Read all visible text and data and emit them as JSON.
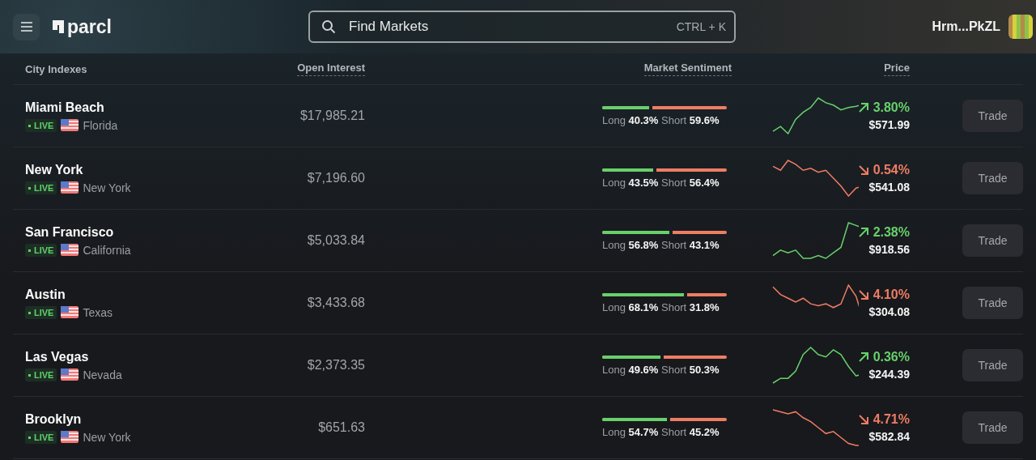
{
  "header": {
    "logo": "parcl",
    "search": {
      "placeholder": "Find Markets",
      "shortcut": "CTRL + K"
    },
    "account": "Hrm...PkZL"
  },
  "table": {
    "columns": [
      "City Indexes",
      "Open Interest",
      "Market Sentiment",
      "Price"
    ],
    "rows": [
      {
        "city": "Miami Beach",
        "status": "LIVE",
        "region": "Florida",
        "open_interest": "$17,985.21",
        "long_label": "Long",
        "long": "40.3%",
        "short_label": "Short",
        "short": "59.6%",
        "level": 0.403,
        "kind": "up",
        "change": "3.80%",
        "price": "$571.99",
        "action": "Trade"
      },
      {
        "city": "New York",
        "status": "LIVE",
        "region": "New York",
        "open_interest": "$7,196.60",
        "long_label": "Long",
        "long": "43.5%",
        "short_label": "Short",
        "short": "56.4%",
        "level": 0.435,
        "kind": "down",
        "change": "0.54%",
        "price": "$541.08",
        "action": "Trade"
      },
      {
        "city": "San Francisco",
        "status": "LIVE",
        "region": "California",
        "open_interest": "$5,033.84",
        "long_label": "Long",
        "long": "56.8%",
        "short_label": "Short",
        "short": "43.1%",
        "level": 0.568,
        "kind": "up",
        "change": "2.38%",
        "price": "$918.56",
        "action": "Trade"
      },
      {
        "city": "Austin",
        "status": "LIVE",
        "region": "Texas",
        "open_interest": "$3,433.68",
        "long_label": "Long",
        "long": "68.1%",
        "short_label": "Short",
        "short": "31.8%",
        "level": 0.681,
        "kind": "down",
        "change": "4.10%",
        "price": "$304.08",
        "action": "Trade"
      },
      {
        "city": "Las Vegas",
        "status": "LIVE",
        "region": "Nevada",
        "open_interest": "$2,373.35",
        "long_label": "Long",
        "long": "49.6%",
        "short_label": "Short",
        "short": "50.3%",
        "level": 0.496,
        "kind": "up",
        "change": "0.36%",
        "price": "$244.39",
        "action": "Trade"
      },
      {
        "city": "Brooklyn",
        "status": "LIVE",
        "region": "New York",
        "open_interest": "$651.63",
        "long_label": "Long",
        "long": "54.7%",
        "short_label": "Short",
        "short": "45.2%",
        "level": 0.547,
        "kind": "down",
        "change": "4.71%",
        "price": "$582.84",
        "action": "Trade"
      }
    ]
  }
}
